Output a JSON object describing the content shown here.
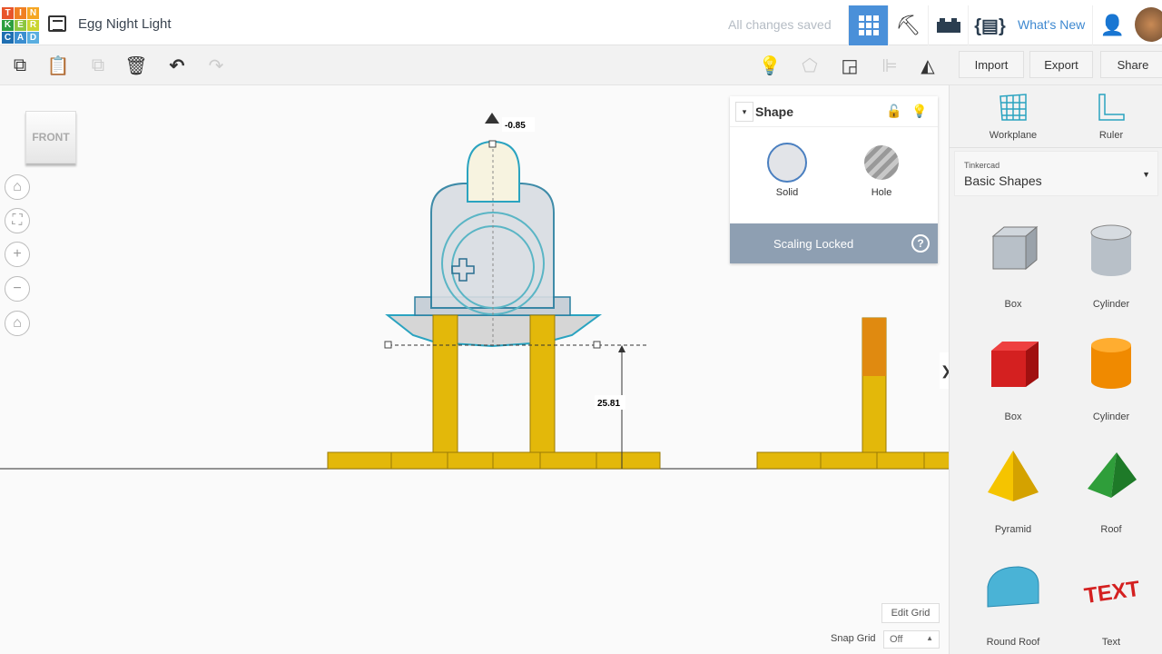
{
  "app": {
    "logo_letters": [
      "T",
      "I",
      "N",
      "K",
      "E",
      "R",
      "C",
      "A",
      "D"
    ],
    "logo_colors": [
      "#e8542a",
      "#f07f22",
      "#f5a623",
      "#2c9f3f",
      "#8cc63f",
      "#cbd531",
      "#1f6fb2",
      "#3b8ed0",
      "#5aaee0"
    ],
    "title": "Egg Night Light",
    "status": "All changes saved",
    "whats_new": "What's New"
  },
  "topnav": {
    "icons": [
      "grid-view-icon",
      "pickaxe-icon",
      "brick-icon",
      "codeblocks-icon"
    ],
    "active_color": "#4a90d9"
  },
  "toolbar": {
    "import": "Import",
    "export": "Export",
    "share": "Share"
  },
  "viewcube": {
    "label": "FRONT"
  },
  "measurements": {
    "top": "-0.85",
    "height": "25.81"
  },
  "inspector": {
    "title": "Shape",
    "solid": "Solid",
    "hole": "Hole",
    "scaling": "Scaling Locked",
    "help": "?"
  },
  "library": {
    "workplane": "Workplane",
    "ruler": "Ruler",
    "source": "Tinkercad",
    "category": "Basic Shapes",
    "shapes": [
      {
        "label": "Box"
      },
      {
        "label": "Cylinder"
      },
      {
        "label": "Box"
      },
      {
        "label": "Cylinder"
      },
      {
        "label": "Pyramid"
      },
      {
        "label": "Roof"
      },
      {
        "label": "Round Roof"
      },
      {
        "label": "Text"
      }
    ]
  },
  "grid": {
    "edit": "Edit Grid",
    "snap_label": "Snap Grid",
    "snap_value": "Off"
  },
  "panel_toggle": "❯"
}
